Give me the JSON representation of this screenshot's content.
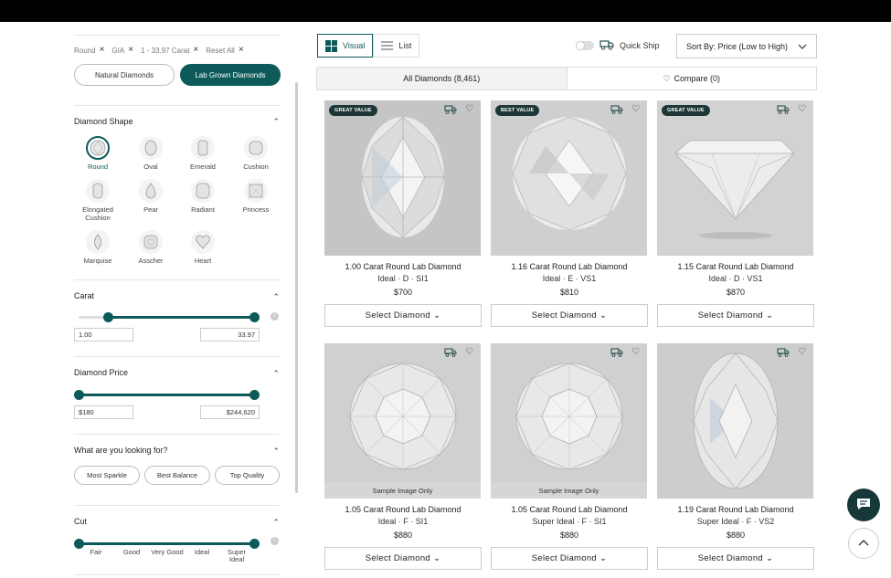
{
  "filters": {
    "chips": [
      "Round",
      "GIA",
      "1 - 33.97 Carat",
      "Reset All"
    ],
    "natural_label": "Natural Diamonds",
    "lab_label": "Lab Grown Diamonds",
    "shape": {
      "title": "Diamond Shape",
      "selected": "Round",
      "items": [
        "Round",
        "Oval",
        "Emerald",
        "Cushion",
        "Elongated Cushion",
        "Pear",
        "Radiant",
        "Princess",
        "Marquise",
        "Asscher",
        "Heart"
      ]
    },
    "carat": {
      "title": "Carat",
      "min": "1.00",
      "max": "33.97"
    },
    "price": {
      "title": "Diamond Price",
      "min": "$180",
      "max": "$244,620"
    },
    "looking": {
      "title": "What are you looking for?",
      "options": [
        "Most Sparkle",
        "Best Balance",
        "Top Quality"
      ]
    },
    "cut": {
      "title": "Cut",
      "grades": [
        "Fair",
        "Good",
        "Very Good",
        "Ideal",
        "Super Ideal"
      ]
    }
  },
  "toolbar": {
    "visual_label": "Visual",
    "list_label": "List",
    "quick_ship_label": "Quick Ship",
    "sort_label": "Sort By: Price (Low to High)"
  },
  "tabs": {
    "all_label": "All Diamonds (8,461)",
    "compare_label": "Compare (0)"
  },
  "products": [
    {
      "title": "1.00 Carat Round Lab Diamond",
      "sub": "Ideal · D · SI1",
      "price": "$700",
      "badge": "GREAT VALUE",
      "sample": "",
      "btn": "Select Diamond"
    },
    {
      "title": "1.16 Carat Round Lab Diamond",
      "sub": "Ideal · E · VS1",
      "price": "$810",
      "badge": "BEST VALUE",
      "sample": "",
      "btn": "Select Diamond"
    },
    {
      "title": "1.15 Carat Round Lab Diamond",
      "sub": "Ideal · D · VS1",
      "price": "$870",
      "badge": "GREAT VALUE",
      "sample": "",
      "btn": "Select Diamond"
    },
    {
      "title": "1.05 Carat Round Lab Diamond",
      "sub": "Ideal · F · SI1",
      "price": "$880",
      "badge": "",
      "sample": "Sample Image Only",
      "btn": "Select Diamond"
    },
    {
      "title": "1.05 Carat Round Lab Diamond",
      "sub": "Super Ideal · F · SI1",
      "price": "$880",
      "badge": "",
      "sample": "Sample Image Only",
      "btn": "Select Diamond"
    },
    {
      "title": "1.19 Carat Round Lab Diamond",
      "sub": "Super Ideal · F · VS2",
      "price": "$880",
      "badge": "",
      "sample": "",
      "btn": "Select Diamond"
    }
  ],
  "colors": {
    "accent": "#0c5a5a",
    "badge": "#1d3737"
  }
}
